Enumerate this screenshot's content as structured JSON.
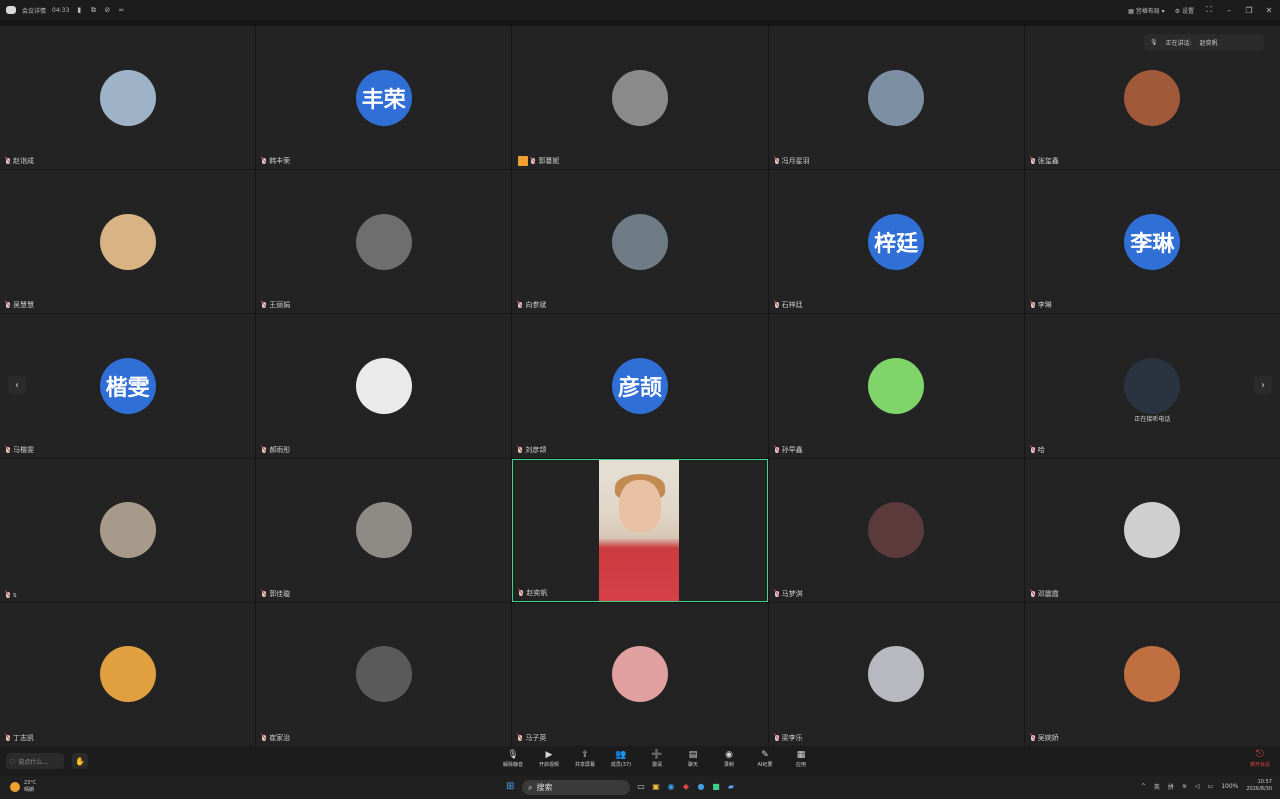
{
  "titlebar": {
    "meeting_info": "会议详情",
    "timer": "04:33",
    "layout": "宫格布局",
    "settings": "设置"
  },
  "speaking": {
    "label": "正在讲话:",
    "name": "赵奕帆"
  },
  "participants": [
    {
      "name": "赵诣成",
      "avatar_text": "",
      "avatar_color": "#9fb3c8"
    },
    {
      "name": "韩丰荣",
      "avatar_text": "丰荣",
      "avatar_color": "#2f6fd6"
    },
    {
      "name": "郭蔓妮",
      "avatar_text": "",
      "avatar_color": "#8a8a8a",
      "host": true
    },
    {
      "name": "冯月星羽",
      "avatar_text": "",
      "avatar_color": "#7d8fa3"
    },
    {
      "name": "张玺鑫",
      "avatar_text": "",
      "avatar_color": "#a05a3a"
    },
    {
      "name": "吴慧慧",
      "avatar_text": "",
      "avatar_color": "#d8b384"
    },
    {
      "name": "王丽娟",
      "avatar_text": "",
      "avatar_color": "#6e6e6e"
    },
    {
      "name": "向参斌",
      "avatar_text": "",
      "avatar_color": "#6f7c86"
    },
    {
      "name": "石梓廷",
      "avatar_text": "梓廷",
      "avatar_color": "#2f6fd6"
    },
    {
      "name": "李琳",
      "avatar_text": "李琳",
      "avatar_color": "#2f6fd6"
    },
    {
      "name": "马楷雯",
      "avatar_text": "楷雯",
      "avatar_color": "#2f6fd6"
    },
    {
      "name": "郝雨彤",
      "avatar_text": "",
      "avatar_color": "#eaeaea"
    },
    {
      "name": "刘彦颉",
      "avatar_text": "彦颉",
      "avatar_color": "#2f6fd6"
    },
    {
      "name": "孙早鑫",
      "avatar_text": "",
      "avatar_color": "#7fd46a"
    },
    {
      "name": "哈",
      "avatar_text": "",
      "avatar_color": "#2a3440",
      "call_text": "正在接听电话"
    },
    {
      "name": "s",
      "avatar_text": "",
      "avatar_color": "#a89a8a"
    },
    {
      "name": "郭佳璇",
      "avatar_text": "",
      "avatar_color": "#8e8a86"
    },
    {
      "name": "赵奕帆",
      "avatar_text": "",
      "avatar_color": "#cc3b40",
      "active": true
    },
    {
      "name": "马梦淇",
      "avatar_text": "",
      "avatar_color": "#5a3a3a"
    },
    {
      "name": "邓震霞",
      "avatar_text": "",
      "avatar_color": "#cfcfcf"
    },
    {
      "name": "丁志凯",
      "avatar_text": "",
      "avatar_color": "#e0a040"
    },
    {
      "name": "崔家治",
      "avatar_text": "",
      "avatar_color": "#5a5a5a"
    },
    {
      "name": "马子英",
      "avatar_text": "",
      "avatar_color": "#e0a0a0"
    },
    {
      "name": "梁李乐",
      "avatar_text": "",
      "avatar_color": "#b8b8c0"
    },
    {
      "name": "吴婉娇",
      "avatar_text": "",
      "avatar_color": "#c07040"
    }
  ],
  "toolbar": {
    "chat_placeholder": "说点什么...",
    "tools": [
      {
        "icon": "mic-icon",
        "label": "解除静音"
      },
      {
        "icon": "camera-icon",
        "label": "开启视频"
      },
      {
        "icon": "share-screen-icon",
        "label": "共享屏幕"
      },
      {
        "icon": "members-icon",
        "label": "成员(37)"
      },
      {
        "icon": "invite-icon",
        "label": "邀请"
      },
      {
        "icon": "chat-icon",
        "label": "聊天"
      },
      {
        "icon": "record-icon",
        "label": "录制"
      },
      {
        "icon": "minutes-icon",
        "label": "AI纪要"
      },
      {
        "icon": "apps-icon",
        "label": "应用"
      }
    ],
    "leave": "离开会议"
  },
  "taskbar": {
    "temperature": "23°C",
    "weather": "晴朗",
    "search_label": "搜索",
    "lang1": "英",
    "lang2": "拼",
    "battery": "100%",
    "time": "10:57",
    "date": "2026/8/30"
  }
}
